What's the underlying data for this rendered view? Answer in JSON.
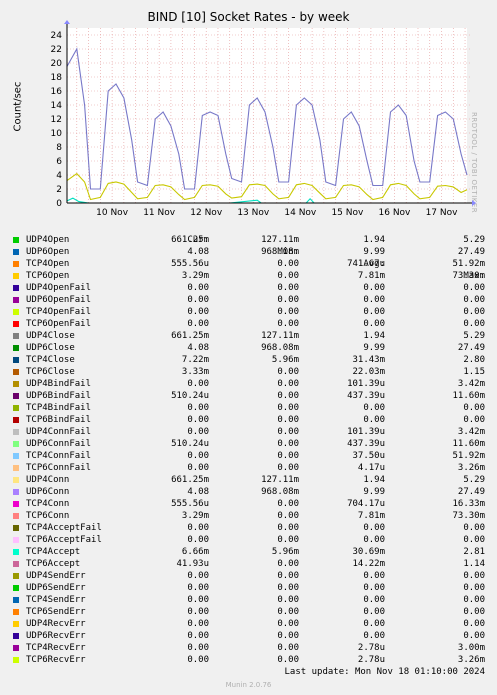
{
  "chart_data": {
    "type": "line",
    "title": "BIND [10] Socket Rates - by week",
    "ylabel": "Count/sec",
    "ylim": [
      0,
      25
    ],
    "yticks": [
      0,
      2,
      4,
      6,
      8,
      10,
      12,
      14,
      16,
      18,
      20,
      22,
      24
    ],
    "x_range": [
      "2024-11-09T13:00",
      "2024-11-18T01:00"
    ],
    "xticks": [
      "10 Nov",
      "11 Nov",
      "12 Nov",
      "13 Nov",
      "14 Nov",
      "15 Nov",
      "16 Nov",
      "17 Nov"
    ],
    "grid": true,
    "watermark": "RRDTOOL / TOBI OETIKER",
    "series": [
      {
        "name": "UDP6Open",
        "color": "#7878c8",
        "points": [
          [
            "2024-11-09T13:00",
            19.5
          ],
          [
            "2024-11-09T18:00",
            22
          ],
          [
            "2024-11-09T22:00",
            14
          ],
          [
            "2024-11-10T01:00",
            2
          ],
          [
            "2024-11-10T06:00",
            2
          ],
          [
            "2024-11-10T10:00",
            16
          ],
          [
            "2024-11-10T14:00",
            17
          ],
          [
            "2024-11-10T18:00",
            15
          ],
          [
            "2024-11-10T22:00",
            9
          ],
          [
            "2024-11-11T01:00",
            3
          ],
          [
            "2024-11-11T06:00",
            2.5
          ],
          [
            "2024-11-11T10:00",
            12
          ],
          [
            "2024-11-11T14:00",
            13
          ],
          [
            "2024-11-11T18:00",
            11
          ],
          [
            "2024-11-11T22:00",
            7
          ],
          [
            "2024-11-12T01:00",
            2
          ],
          [
            "2024-11-12T06:00",
            2
          ],
          [
            "2024-11-12T10:00",
            12.5
          ],
          [
            "2024-11-12T14:00",
            13
          ],
          [
            "2024-11-12T18:00",
            12.5
          ],
          [
            "2024-11-12T22:00",
            7
          ],
          [
            "2024-11-13T01:00",
            3.5
          ],
          [
            "2024-11-13T06:00",
            3
          ],
          [
            "2024-11-13T10:00",
            14
          ],
          [
            "2024-11-13T14:00",
            15
          ],
          [
            "2024-11-13T18:00",
            13
          ],
          [
            "2024-11-13T22:00",
            8
          ],
          [
            "2024-11-14T01:00",
            3
          ],
          [
            "2024-11-14T06:00",
            3
          ],
          [
            "2024-11-14T10:00",
            14
          ],
          [
            "2024-11-14T14:00",
            15
          ],
          [
            "2024-11-14T18:00",
            14
          ],
          [
            "2024-11-14T22:00",
            9
          ],
          [
            "2024-11-15T01:00",
            3
          ],
          [
            "2024-11-15T06:00",
            2.5
          ],
          [
            "2024-11-15T10:00",
            12
          ],
          [
            "2024-11-15T14:00",
            13
          ],
          [
            "2024-11-15T18:00",
            11
          ],
          [
            "2024-11-15T22:00",
            6
          ],
          [
            "2024-11-16T01:00",
            2.5
          ],
          [
            "2024-11-16T06:00",
            2.5
          ],
          [
            "2024-11-16T10:00",
            13
          ],
          [
            "2024-11-16T14:00",
            14
          ],
          [
            "2024-11-16T18:00",
            12.5
          ],
          [
            "2024-11-16T22:00",
            6
          ],
          [
            "2024-11-17T01:00",
            3
          ],
          [
            "2024-11-17T06:00",
            3
          ],
          [
            "2024-11-17T10:00",
            12.5
          ],
          [
            "2024-11-17T14:00",
            13
          ],
          [
            "2024-11-17T18:00",
            12
          ],
          [
            "2024-11-17T22:00",
            7
          ],
          [
            "2024-11-18T01:00",
            4
          ]
        ]
      },
      {
        "name": "UDP4Open",
        "color": "#c8c800",
        "points": [
          [
            "2024-11-09T13:00",
            3.2
          ],
          [
            "2024-11-09T18:00",
            4.2
          ],
          [
            "2024-11-09T22:00",
            3
          ],
          [
            "2024-11-10T01:00",
            0.5
          ],
          [
            "2024-11-10T06:00",
            0.8
          ],
          [
            "2024-11-10T10:00",
            2.8
          ],
          [
            "2024-11-10T14:00",
            3
          ],
          [
            "2024-11-10T18:00",
            2.7
          ],
          [
            "2024-11-10T22:00",
            1.5
          ],
          [
            "2024-11-11T01:00",
            0.6
          ],
          [
            "2024-11-11T06:00",
            0.8
          ],
          [
            "2024-11-11T10:00",
            2.5
          ],
          [
            "2024-11-11T14:00",
            2.6
          ],
          [
            "2024-11-11T18:00",
            2.3
          ],
          [
            "2024-11-11T22:00",
            1.2
          ],
          [
            "2024-11-12T01:00",
            0.5
          ],
          [
            "2024-11-12T06:00",
            0.8
          ],
          [
            "2024-11-12T10:00",
            2.5
          ],
          [
            "2024-11-12T14:00",
            2.6
          ],
          [
            "2024-11-12T18:00",
            2.4
          ],
          [
            "2024-11-12T22:00",
            1.3
          ],
          [
            "2024-11-13T01:00",
            0.7
          ],
          [
            "2024-11-13T06:00",
            0.9
          ],
          [
            "2024-11-13T10:00",
            2.6
          ],
          [
            "2024-11-13T14:00",
            2.7
          ],
          [
            "2024-11-13T18:00",
            2.5
          ],
          [
            "2024-11-13T22:00",
            1.3
          ],
          [
            "2024-11-14T01:00",
            0.6
          ],
          [
            "2024-11-14T06:00",
            0.8
          ],
          [
            "2024-11-14T10:00",
            2.6
          ],
          [
            "2024-11-14T14:00",
            2.8
          ],
          [
            "2024-11-14T18:00",
            2.5
          ],
          [
            "2024-11-14T22:00",
            1.4
          ],
          [
            "2024-11-15T01:00",
            0.6
          ],
          [
            "2024-11-15T06:00",
            0.8
          ],
          [
            "2024-11-15T10:00",
            2.5
          ],
          [
            "2024-11-15T14:00",
            2.6
          ],
          [
            "2024-11-15T18:00",
            2.3
          ],
          [
            "2024-11-15T22:00",
            1.2
          ],
          [
            "2024-11-16T01:00",
            0.5
          ],
          [
            "2024-11-16T06:00",
            0.8
          ],
          [
            "2024-11-16T10:00",
            2.6
          ],
          [
            "2024-11-16T14:00",
            2.8
          ],
          [
            "2024-11-16T18:00",
            2.5
          ],
          [
            "2024-11-16T22:00",
            1.3
          ],
          [
            "2024-11-17T01:00",
            0.6
          ],
          [
            "2024-11-17T06:00",
            0.8
          ],
          [
            "2024-11-17T10:00",
            2.4
          ],
          [
            "2024-11-17T14:00",
            2.5
          ],
          [
            "2024-11-17T18:00",
            2.3
          ],
          [
            "2024-11-17T22:00",
            1.5
          ],
          [
            "2024-11-18T01:00",
            1.9
          ]
        ]
      },
      {
        "name": "TCP4Accept",
        "color": "#00e0c0",
        "points": [
          [
            "2024-11-09T13:00",
            0.3
          ],
          [
            "2024-11-09T16:00",
            0.7
          ],
          [
            "2024-11-09T19:00",
            0.2
          ],
          [
            "2024-11-10T00:00",
            0
          ],
          [
            "2024-11-13T00:00",
            0
          ],
          [
            "2024-11-13T14:00",
            0.4
          ],
          [
            "2024-11-13T16:00",
            0
          ],
          [
            "2024-11-14T15:00",
            0
          ],
          [
            "2024-11-14T17:00",
            0.6
          ],
          [
            "2024-11-14T19:00",
            0
          ],
          [
            "2024-11-18T01:00",
            0
          ]
        ]
      }
    ]
  },
  "legend": {
    "headers": {
      "cur": "Cur:",
      "min": "Min:",
      "avg": "Avg:",
      "max": "Max:"
    },
    "rows": [
      {
        "name": "UDP4Open",
        "color": "#00cc00",
        "cur": "661.25m",
        "min": "127.11m",
        "avg": "1.94",
        "max": "5.29"
      },
      {
        "name": "UDP6Open",
        "color": "#0066b3",
        "cur": "4.08",
        "min": "968.08m",
        "avg": "9.99",
        "max": "27.49"
      },
      {
        "name": "TCP4Open",
        "color": "#ff8000",
        "cur": "555.56u",
        "min": "0.00",
        "avg": "741.67u",
        "max": "51.92m"
      },
      {
        "name": "TCP6Open",
        "color": "#ffcc00",
        "cur": "3.29m",
        "min": "0.00",
        "avg": "7.81m",
        "max": "73.30m"
      },
      {
        "name": "UDP4OpenFail",
        "color": "#330099",
        "cur": "0.00",
        "min": "0.00",
        "avg": "0.00",
        "max": "0.00"
      },
      {
        "name": "UDP6OpenFail",
        "color": "#990099",
        "cur": "0.00",
        "min": "0.00",
        "avg": "0.00",
        "max": "0.00"
      },
      {
        "name": "TCP4OpenFail",
        "color": "#ccff00",
        "cur": "0.00",
        "min": "0.00",
        "avg": "0.00",
        "max": "0.00"
      },
      {
        "name": "TCP6OpenFail",
        "color": "#ff0000",
        "cur": "0.00",
        "min": "0.00",
        "avg": "0.00",
        "max": "0.00"
      },
      {
        "name": "UDP4Close",
        "color": "#808080",
        "cur": "661.25m",
        "min": "127.11m",
        "avg": "1.94",
        "max": "5.29"
      },
      {
        "name": "UDP6Close",
        "color": "#008f00",
        "cur": "4.08",
        "min": "968.08m",
        "avg": "9.99",
        "max": "27.49"
      },
      {
        "name": "TCP4Close",
        "color": "#00487d",
        "cur": "7.22m",
        "min": "5.96m",
        "avg": "31.43m",
        "max": "2.80"
      },
      {
        "name": "TCP6Close",
        "color": "#b35a00",
        "cur": "3.33m",
        "min": "0.00",
        "avg": "22.03m",
        "max": "1.15"
      },
      {
        "name": "UDP4BindFail",
        "color": "#b38f00",
        "cur": "0.00",
        "min": "0.00",
        "avg": "101.39u",
        "max": "3.42m"
      },
      {
        "name": "UDP6BindFail",
        "color": "#6b006b",
        "cur": "510.24u",
        "min": "0.00",
        "avg": "437.39u",
        "max": "11.60m"
      },
      {
        "name": "TCP4BindFail",
        "color": "#8fb300",
        "cur": "0.00",
        "min": "0.00",
        "avg": "0.00",
        "max": "0.00"
      },
      {
        "name": "TCP6BindFail",
        "color": "#b30000",
        "cur": "0.00",
        "min": "0.00",
        "avg": "0.00",
        "max": "0.00"
      },
      {
        "name": "UDP4ConnFail",
        "color": "#bebebe",
        "cur": "0.00",
        "min": "0.00",
        "avg": "101.39u",
        "max": "3.42m"
      },
      {
        "name": "UDP6ConnFail",
        "color": "#80ff80",
        "cur": "510.24u",
        "min": "0.00",
        "avg": "437.39u",
        "max": "11.60m"
      },
      {
        "name": "TCP4ConnFail",
        "color": "#80c9ff",
        "cur": "0.00",
        "min": "0.00",
        "avg": "37.50u",
        "max": "51.92m"
      },
      {
        "name": "TCP6ConnFail",
        "color": "#ffc080",
        "cur": "0.00",
        "min": "0.00",
        "avg": "4.17u",
        "max": "3.26m"
      },
      {
        "name": "UDP4Conn",
        "color": "#ffe680",
        "cur": "661.25m",
        "min": "127.11m",
        "avg": "1.94",
        "max": "5.29"
      },
      {
        "name": "UDP6Conn",
        "color": "#aa80ff",
        "cur": "4.08",
        "min": "968.08m",
        "avg": "9.99",
        "max": "27.49"
      },
      {
        "name": "TCP4Conn",
        "color": "#ee00cc",
        "cur": "555.56u",
        "min": "0.00",
        "avg": "704.17u",
        "max": "16.33m"
      },
      {
        "name": "TCP6Conn",
        "color": "#ff8080",
        "cur": "3.29m",
        "min": "0.00",
        "avg": "7.81m",
        "max": "73.30m"
      },
      {
        "name": "TCP4AcceptFail",
        "color": "#666600",
        "cur": "0.00",
        "min": "0.00",
        "avg": "0.00",
        "max": "0.00"
      },
      {
        "name": "TCP6AcceptFail",
        "color": "#ffbfff",
        "cur": "0.00",
        "min": "0.00",
        "avg": "0.00",
        "max": "0.00"
      },
      {
        "name": "TCP4Accept",
        "color": "#00ffcc",
        "cur": "6.66m",
        "min": "5.96m",
        "avg": "30.69m",
        "max": "2.81"
      },
      {
        "name": "TCP6Accept",
        "color": "#cc6699",
        "cur": "41.93u",
        "min": "0.00",
        "avg": "14.22m",
        "max": "1.14"
      },
      {
        "name": "UDP4SendErr",
        "color": "#999900",
        "cur": "0.00",
        "min": "0.00",
        "avg": "0.00",
        "max": "0.00"
      },
      {
        "name": "UDP6SendErr",
        "color": "#00cc00",
        "cur": "0.00",
        "min": "0.00",
        "avg": "0.00",
        "max": "0.00"
      },
      {
        "name": "TCP4SendErr",
        "color": "#0066b3",
        "cur": "0.00",
        "min": "0.00",
        "avg": "0.00",
        "max": "0.00"
      },
      {
        "name": "TCP6SendErr",
        "color": "#ff8000",
        "cur": "0.00",
        "min": "0.00",
        "avg": "0.00",
        "max": "0.00"
      },
      {
        "name": "UDP4RecvErr",
        "color": "#ffcc00",
        "cur": "0.00",
        "min": "0.00",
        "avg": "0.00",
        "max": "0.00"
      },
      {
        "name": "UDP6RecvErr",
        "color": "#330099",
        "cur": "0.00",
        "min": "0.00",
        "avg": "0.00",
        "max": "0.00"
      },
      {
        "name": "TCP4RecvErr",
        "color": "#990099",
        "cur": "0.00",
        "min": "0.00",
        "avg": "2.78u",
        "max": "3.00m"
      },
      {
        "name": "TCP6RecvErr",
        "color": "#ccff00",
        "cur": "0.00",
        "min": "0.00",
        "avg": "2.78u",
        "max": "3.26m"
      }
    ]
  },
  "footer": {
    "last_update": "Last update: Mon Nov 18 01:10:00 2024",
    "munin": "Munin 2.0.76"
  }
}
